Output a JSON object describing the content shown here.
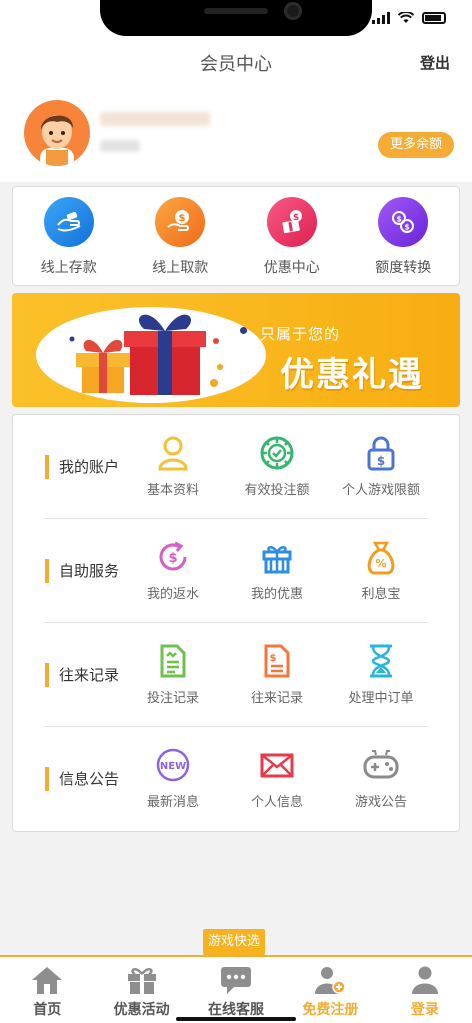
{
  "header": {
    "title": "会员中心",
    "logout_label": "登出"
  },
  "profile": {
    "more_balance_label": "更多余额"
  },
  "quick_actions": [
    {
      "label": "线上存款",
      "icon": "deposit-hand-icon",
      "color": "#2a8df2"
    },
    {
      "label": "线上取款",
      "icon": "withdraw-coin-icon",
      "color": "#f7872a"
    },
    {
      "label": "优惠中心",
      "icon": "promo-ticket-icon",
      "color": "#f03c6a"
    },
    {
      "label": "额度转换",
      "icon": "transfer-coins-icon",
      "color": "#8a3cf0"
    }
  ],
  "banner": {
    "subtitle": "只属于您的",
    "title": "优惠礼遇"
  },
  "sections": [
    {
      "title": "我的账户",
      "items": [
        {
          "label": "基本资料",
          "icon": "user-icon",
          "color": "#f4c036"
        },
        {
          "label": "有效投注额",
          "icon": "chip-icon",
          "color": "#35b56e"
        },
        {
          "label": "个人游戏限额",
          "icon": "lock-dollar-icon",
          "color": "#4c74d4"
        }
      ]
    },
    {
      "title": "自助服务",
      "items": [
        {
          "label": "我的返水",
          "icon": "refund-icon",
          "color": "#d65ec8"
        },
        {
          "label": "我的优惠",
          "icon": "gift-icon",
          "color": "#2e8de0"
        },
        {
          "label": "利息宝",
          "icon": "money-bag-icon",
          "color": "#f39c1e"
        }
      ]
    },
    {
      "title": "往来记录",
      "items": [
        {
          "label": "投注记录",
          "icon": "bet-record-icon",
          "color": "#6fc04d"
        },
        {
          "label": "往来记录",
          "icon": "transaction-record-icon",
          "color": "#f4773a"
        },
        {
          "label": "处理中订单",
          "icon": "hourglass-icon",
          "color": "#27b6d8"
        }
      ]
    },
    {
      "title": "信息公告",
      "items": [
        {
          "label": "最新消息",
          "icon": "new-badge-icon",
          "color": "#8d63e0",
          "badge": "NEW"
        },
        {
          "label": "个人信息",
          "icon": "envelope-icon",
          "color": "#e83a4a"
        },
        {
          "label": "游戏公告",
          "icon": "gamepad-icon",
          "color": "#8a8a8a"
        }
      ]
    }
  ],
  "quick_game_label": "游戏快选",
  "tabs": [
    {
      "label": "首页",
      "icon": "home-icon"
    },
    {
      "label": "优惠活动",
      "icon": "gift-box-icon"
    },
    {
      "label": "在线客服",
      "icon": "chat-icon"
    },
    {
      "label": "免费注册",
      "icon": "register-user-icon",
      "active": true
    },
    {
      "label": "登录",
      "icon": "login-user-icon",
      "active": true
    }
  ]
}
